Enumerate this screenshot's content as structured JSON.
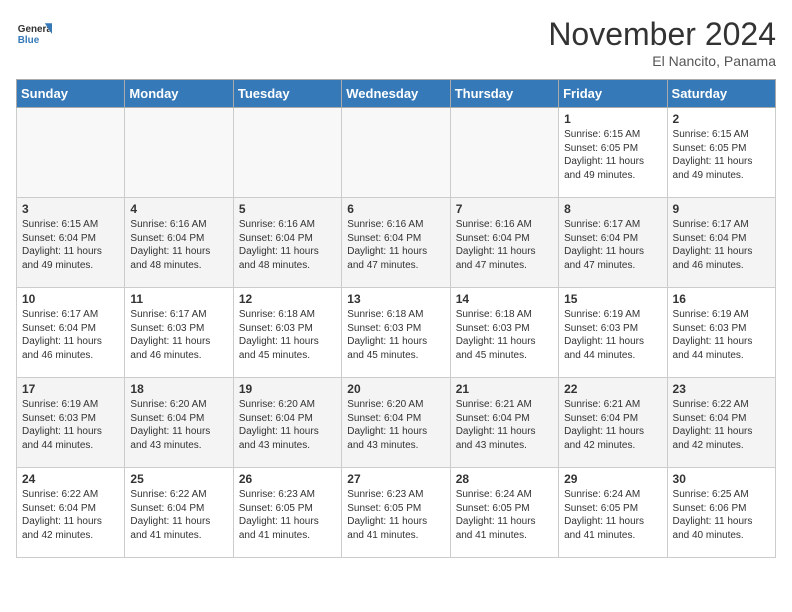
{
  "header": {
    "logo_line1": "General",
    "logo_line2": "Blue",
    "month": "November 2024",
    "location": "El Nancito, Panama"
  },
  "weekdays": [
    "Sunday",
    "Monday",
    "Tuesday",
    "Wednesday",
    "Thursday",
    "Friday",
    "Saturday"
  ],
  "weeks": [
    [
      {
        "day": "",
        "info": ""
      },
      {
        "day": "",
        "info": ""
      },
      {
        "day": "",
        "info": ""
      },
      {
        "day": "",
        "info": ""
      },
      {
        "day": "",
        "info": ""
      },
      {
        "day": "1",
        "info": "Sunrise: 6:15 AM\nSunset: 6:05 PM\nDaylight: 11 hours and 49 minutes."
      },
      {
        "day": "2",
        "info": "Sunrise: 6:15 AM\nSunset: 6:05 PM\nDaylight: 11 hours and 49 minutes."
      }
    ],
    [
      {
        "day": "3",
        "info": "Sunrise: 6:15 AM\nSunset: 6:04 PM\nDaylight: 11 hours and 49 minutes."
      },
      {
        "day": "4",
        "info": "Sunrise: 6:16 AM\nSunset: 6:04 PM\nDaylight: 11 hours and 48 minutes."
      },
      {
        "day": "5",
        "info": "Sunrise: 6:16 AM\nSunset: 6:04 PM\nDaylight: 11 hours and 48 minutes."
      },
      {
        "day": "6",
        "info": "Sunrise: 6:16 AM\nSunset: 6:04 PM\nDaylight: 11 hours and 47 minutes."
      },
      {
        "day": "7",
        "info": "Sunrise: 6:16 AM\nSunset: 6:04 PM\nDaylight: 11 hours and 47 minutes."
      },
      {
        "day": "8",
        "info": "Sunrise: 6:17 AM\nSunset: 6:04 PM\nDaylight: 11 hours and 47 minutes."
      },
      {
        "day": "9",
        "info": "Sunrise: 6:17 AM\nSunset: 6:04 PM\nDaylight: 11 hours and 46 minutes."
      }
    ],
    [
      {
        "day": "10",
        "info": "Sunrise: 6:17 AM\nSunset: 6:04 PM\nDaylight: 11 hours and 46 minutes."
      },
      {
        "day": "11",
        "info": "Sunrise: 6:17 AM\nSunset: 6:03 PM\nDaylight: 11 hours and 46 minutes."
      },
      {
        "day": "12",
        "info": "Sunrise: 6:18 AM\nSunset: 6:03 PM\nDaylight: 11 hours and 45 minutes."
      },
      {
        "day": "13",
        "info": "Sunrise: 6:18 AM\nSunset: 6:03 PM\nDaylight: 11 hours and 45 minutes."
      },
      {
        "day": "14",
        "info": "Sunrise: 6:18 AM\nSunset: 6:03 PM\nDaylight: 11 hours and 45 minutes."
      },
      {
        "day": "15",
        "info": "Sunrise: 6:19 AM\nSunset: 6:03 PM\nDaylight: 11 hours and 44 minutes."
      },
      {
        "day": "16",
        "info": "Sunrise: 6:19 AM\nSunset: 6:03 PM\nDaylight: 11 hours and 44 minutes."
      }
    ],
    [
      {
        "day": "17",
        "info": "Sunrise: 6:19 AM\nSunset: 6:03 PM\nDaylight: 11 hours and 44 minutes."
      },
      {
        "day": "18",
        "info": "Sunrise: 6:20 AM\nSunset: 6:04 PM\nDaylight: 11 hours and 43 minutes."
      },
      {
        "day": "19",
        "info": "Sunrise: 6:20 AM\nSunset: 6:04 PM\nDaylight: 11 hours and 43 minutes."
      },
      {
        "day": "20",
        "info": "Sunrise: 6:20 AM\nSunset: 6:04 PM\nDaylight: 11 hours and 43 minutes."
      },
      {
        "day": "21",
        "info": "Sunrise: 6:21 AM\nSunset: 6:04 PM\nDaylight: 11 hours and 43 minutes."
      },
      {
        "day": "22",
        "info": "Sunrise: 6:21 AM\nSunset: 6:04 PM\nDaylight: 11 hours and 42 minutes."
      },
      {
        "day": "23",
        "info": "Sunrise: 6:22 AM\nSunset: 6:04 PM\nDaylight: 11 hours and 42 minutes."
      }
    ],
    [
      {
        "day": "24",
        "info": "Sunrise: 6:22 AM\nSunset: 6:04 PM\nDaylight: 11 hours and 42 minutes."
      },
      {
        "day": "25",
        "info": "Sunrise: 6:22 AM\nSunset: 6:04 PM\nDaylight: 11 hours and 41 minutes."
      },
      {
        "day": "26",
        "info": "Sunrise: 6:23 AM\nSunset: 6:05 PM\nDaylight: 11 hours and 41 minutes."
      },
      {
        "day": "27",
        "info": "Sunrise: 6:23 AM\nSunset: 6:05 PM\nDaylight: 11 hours and 41 minutes."
      },
      {
        "day": "28",
        "info": "Sunrise: 6:24 AM\nSunset: 6:05 PM\nDaylight: 11 hours and 41 minutes."
      },
      {
        "day": "29",
        "info": "Sunrise: 6:24 AM\nSunset: 6:05 PM\nDaylight: 11 hours and 41 minutes."
      },
      {
        "day": "30",
        "info": "Sunrise: 6:25 AM\nSunset: 6:06 PM\nDaylight: 11 hours and 40 minutes."
      }
    ]
  ]
}
